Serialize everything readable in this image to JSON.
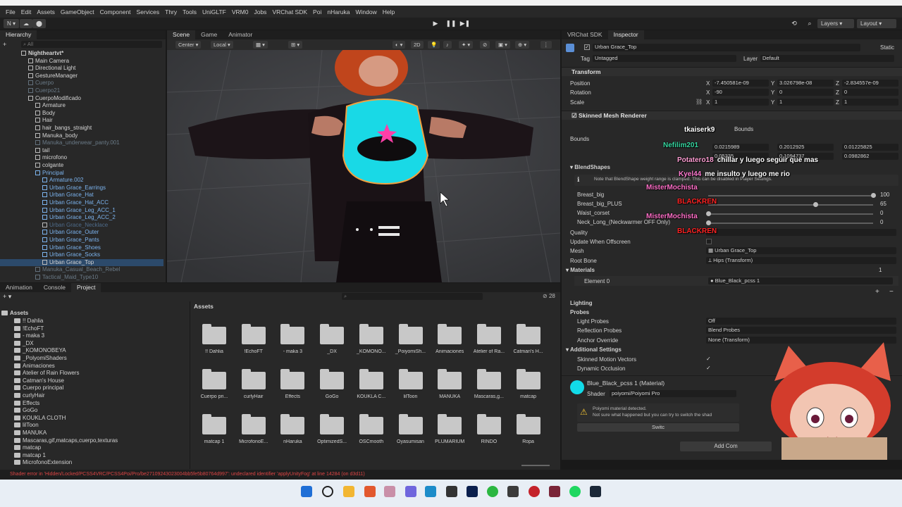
{
  "menu": [
    "File",
    "Edit",
    "Assets",
    "GameObject",
    "Component",
    "Services",
    "Thry",
    "Tools",
    "UniGLTF",
    "VRM0",
    "Jobs",
    "VRChat SDK",
    "Poi",
    "nHaruka",
    "Window",
    "Help"
  ],
  "toolbar": {
    "account": "N",
    "layers": "Layers",
    "layout": "Layout"
  },
  "hierarchy": {
    "tab": "Hierarchy",
    "search_placeholder": "All",
    "rows": [
      {
        "label": "Nightheartvt*",
        "indent": 0,
        "style": "root"
      },
      {
        "label": "Main Camera",
        "indent": 1,
        "style": ""
      },
      {
        "label": "Directional Light",
        "indent": 1,
        "style": ""
      },
      {
        "label": "GestureManager",
        "indent": 1,
        "style": ""
      },
      {
        "label": "Cuerpo",
        "indent": 1,
        "style": "dim"
      },
      {
        "label": "Cuerpo21",
        "indent": 1,
        "style": "dim"
      },
      {
        "label": "CuerpoModificado",
        "indent": 1,
        "style": ""
      },
      {
        "label": "Armature",
        "indent": 2,
        "style": ""
      },
      {
        "label": "Body",
        "indent": 2,
        "style": ""
      },
      {
        "label": "Hair",
        "indent": 2,
        "style": ""
      },
      {
        "label": "hair_bangs_straight",
        "indent": 2,
        "style": ""
      },
      {
        "label": "Manuka_body",
        "indent": 2,
        "style": ""
      },
      {
        "label": "Manuka_underwear_panty.001",
        "indent": 2,
        "style": "dim"
      },
      {
        "label": "tail",
        "indent": 2,
        "style": ""
      },
      {
        "label": "microfono",
        "indent": 2,
        "style": ""
      },
      {
        "label": "colgante",
        "indent": 2,
        "style": ""
      },
      {
        "label": "Principal",
        "indent": 2,
        "style": "blue"
      },
      {
        "label": "Armature.002",
        "indent": 3,
        "style": "blue"
      },
      {
        "label": "Urban Grace_Earrings",
        "indent": 3,
        "style": "blue"
      },
      {
        "label": "Urban Grace_Hat",
        "indent": 3,
        "style": "blue"
      },
      {
        "label": "Urban Grace_Hat_ACC",
        "indent": 3,
        "style": "blue"
      },
      {
        "label": "Urban Grace_Leg_ACC_1",
        "indent": 3,
        "style": "blue"
      },
      {
        "label": "Urban Grace_Leg_ACC_2",
        "indent": 3,
        "style": "blue"
      },
      {
        "label": "Urban Grace_Necklace",
        "indent": 3,
        "style": "dimblue"
      },
      {
        "label": "Urban Grace_Outer",
        "indent": 3,
        "style": "blue"
      },
      {
        "label": "Urban Grace_Pants",
        "indent": 3,
        "style": "blue"
      },
      {
        "label": "Urban Grace_Shoes",
        "indent": 3,
        "style": "blue"
      },
      {
        "label": "Urban Grace_Socks",
        "indent": 3,
        "style": "blue"
      },
      {
        "label": "Urban Grace_Top",
        "indent": 3,
        "style": "sel"
      },
      {
        "label": "Manuka_Casual_Beach_Rebel",
        "indent": 2,
        "style": "dim"
      },
      {
        "label": "Tactical_Maid_Type10",
        "indent": 2,
        "style": "dim"
      }
    ]
  },
  "scene": {
    "tabs": [
      "Scene",
      "Game",
      "Animator"
    ],
    "pivot": "Center",
    "space": "Local",
    "mode_2d": "2D"
  },
  "inspector": {
    "tabs": [
      "VRChat SDK",
      "Inspector"
    ],
    "object_name": "Urban Grace_Top",
    "static_label": "Static",
    "tag_label": "Tag",
    "tag_value": "Untagged",
    "layer_label": "Layer",
    "layer_value": "Default",
    "transform": {
      "title": "Transform",
      "position_label": "Position",
      "rotation_label": "Rotation",
      "scale_label": "Scale",
      "pos": [
        "-7.450581e-09",
        "3.026798e-08",
        "-2.834557e-09"
      ],
      "rot": [
        "-90",
        "0",
        "0"
      ],
      "scale": [
        "1",
        "1",
        "1"
      ]
    },
    "smr": {
      "title": "Skinned Mesh Renderer",
      "bounds_label": "Bounds",
      "bounds_text": "Bounds",
      "bounds_vals": [
        "0.0215989",
        "0.2012925",
        "0.01225825",
        "0.05335",
        "0.1094737",
        "0.0982862"
      ],
      "blendshapes_title": "BlendShapes",
      "note": "Note that BlendShape weight range is clamped. This can be disabled in Player Settings.",
      "shapes": [
        {
          "name": "Breast_big",
          "value": "100",
          "fill": 1.0
        },
        {
          "name": "Breast_big_PLUS",
          "value": "65",
          "fill": 0.65
        },
        {
          "name": "Waist_corset",
          "value": "0",
          "fill": 0
        },
        {
          "name": "Neck_Long_(Neckwarmer OFF Only)",
          "value": "0",
          "fill": 0
        }
      ],
      "quality_label": "Quality",
      "update_offscreen_label": "Update When Offscreen",
      "mesh_label": "Mesh",
      "mesh_value": "Urban Grace_Top",
      "root_bone_label": "Root Bone",
      "root_bone_value": "Hips (Transform)",
      "materials_title": "Materials",
      "materials_count": "1",
      "element0_label": "Element 0",
      "element0_value": "Blue_Black_pcss 1",
      "lighting_title": "Lighting",
      "probes_title": "Probes",
      "light_probes_label": "Light Probes",
      "light_probes_value": "Off",
      "reflection_probes_label": "Reflection Probes",
      "reflection_probes_value": "Blend Probes",
      "anchor_label": "Anchor Override",
      "anchor_value": "None (Transform)",
      "additional_title": "Additional Settings",
      "motion_vectors_label": "Skinned Motion Vectors",
      "dynamic_occlusion_label": "Dynamic Occlusion"
    },
    "material": {
      "name": "Blue_Black_pcss 1 (Material)",
      "shader_label": "Shader",
      "shader_value": "poiyomi/Poiyomi Pro",
      "warning_line1": "Poiyomi material detected.",
      "warning_line2": "Not sure what happened but you can try to switch the shad",
      "switch_button": "Switc",
      "add_component": "Add Com"
    }
  },
  "chat": [
    {
      "user": "tkaiserk9",
      "text": "",
      "color": "#ffffff"
    },
    {
      "user": "Nefilim201",
      "text": "",
      "color": "#36d6a0"
    },
    {
      "user": "Potatero18",
      "text": "chillar y luego seguir que mas",
      "color": "#ff9ed4"
    },
    {
      "user": "Kyel44",
      "text": "me insulto y luego me rio",
      "color": "#ff7ad1"
    },
    {
      "user": "MisterMochista",
      "text": "",
      "color": "#ff6fc8"
    },
    {
      "user": "BLACKREN",
      "text": "",
      "color": "#ff2222"
    },
    {
      "user": "MisterMochista",
      "text": "",
      "color": "#ff6fc8"
    },
    {
      "user": "BLACKREN",
      "text": "",
      "color": "#ff2222"
    }
  ],
  "bottom": {
    "tabs": [
      "Animation",
      "Console",
      "Project"
    ],
    "assets_root": "Assets",
    "breadcrumb": "Assets",
    "count_badge": "28",
    "tree": [
      "!! Dahlia",
      "!EchoFT",
      "- maka 3",
      "_DX",
      "_KOMONOBEYA",
      "_PolyomiShaders",
      "Animaciones",
      "Atelier of Rain Flowers",
      "Catman's House",
      "Cuerpo principal",
      "curlyHair",
      "Effects",
      "GoGo",
      "KOUKLA CLOTH",
      "lilToon",
      "MANUKA",
      "Mascaras,gif,matcaps,cuerpo,texturas",
      "matcap",
      "matcap 1",
      "MicrofonoExtension"
    ],
    "grid": [
      "!! Dahlia",
      "!EchoFT",
      "- maka 3",
      "_DX",
      "_KOMONO...",
      "_PoiyomiSh...",
      "Animaciones",
      "Atelier of Ra...",
      "Catman's H...",
      "Cuerpo pri...",
      "curlyHair",
      "Effects",
      "GoGo",
      "KOUKLA C...",
      "lilToon",
      "MANUKA",
      "Mascaras,g...",
      "matcap",
      "matcap 1",
      "MicrofonoE...",
      "nHaruka",
      "OptimizedS...",
      "OSCmooth",
      "Oyasumisan",
      "PLUMARIUM",
      "RINDO",
      "Ropa"
    ]
  },
  "status": "Shader error in 'Hidden/Locked/PCSS4VRC/PCSS4Poi/Pro/be27109243023004bb5fe5b80764d997': undeclared identifier 'applyUnityFog' at line 14284 (on d3d11)"
}
